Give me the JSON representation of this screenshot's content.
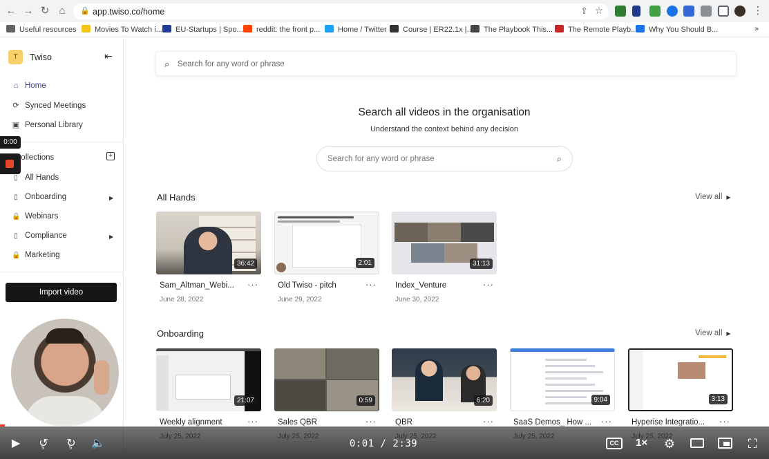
{
  "browser": {
    "url": "app.twiso.co/home",
    "bookmarks": [
      {
        "label": "Useful resources",
        "color": "#5f6368"
      },
      {
        "label": "Movies To Watch i...",
        "color": "#f5c518"
      },
      {
        "label": "EU-Startups | Spo...",
        "color": "#1f3b99"
      },
      {
        "label": "reddit: the front p...",
        "color": "#ff4500"
      },
      {
        "label": "Home / Twitter",
        "color": "#1da1f2"
      },
      {
        "label": "Course | ER22.1x |...",
        "color": "#333333"
      },
      {
        "label": "The Playbook This...",
        "color": "#444444"
      },
      {
        "label": "The Remote Playb...",
        "color": "#c62828"
      },
      {
        "label": "Why You Should B...",
        "color": "#1a73e8"
      }
    ],
    "more_bookmarks": "»"
  },
  "sidebar": {
    "org_initial": "T",
    "org_name": "Twiso",
    "nav": [
      {
        "label": "Home",
        "icon": "home-icon",
        "glyph": "⌂"
      },
      {
        "label": "Synced Meetings",
        "icon": "sync-icon",
        "glyph": "⟳"
      },
      {
        "label": "Personal Library",
        "icon": "library-icon",
        "glyph": "▣"
      }
    ],
    "collections_label": "Collections",
    "collections": [
      {
        "label": "All Hands",
        "icon": "document-icon",
        "glyph": "▯",
        "expandable": false
      },
      {
        "label": "Onboarding",
        "icon": "document-icon",
        "glyph": "▯",
        "expandable": true
      },
      {
        "label": "Webinars",
        "icon": "lock-icon",
        "glyph": "🔒",
        "expandable": false
      },
      {
        "label": "Compliance",
        "icon": "document-icon",
        "glyph": "▯",
        "expandable": true
      },
      {
        "label": "Marketing",
        "icon": "lock-icon",
        "glyph": "🔒",
        "expandable": false
      }
    ],
    "import_button": "Import video"
  },
  "recorder": {
    "timer": "0:00"
  },
  "main": {
    "top_search_placeholder": "Search for any word or phrase",
    "hero_title": "Search all videos in the organisation",
    "hero_subtitle": "Understand the context behind any decision",
    "hero_search_placeholder": "Search for any word or phrase",
    "view_all": "View all",
    "sections": [
      {
        "title": "All Hands",
        "videos": [
          {
            "title": "Sam_Altman_Webi...",
            "duration": "36:42",
            "date": "June 28, 2022",
            "thumb": "office"
          },
          {
            "title": "Old Twiso - pitch",
            "duration": "2:01",
            "date": "June 29, 2022",
            "thumb": "doc"
          },
          {
            "title": "Index_Venture",
            "duration": "31:13",
            "date": "June 30, 2022",
            "thumb": "grid"
          }
        ]
      },
      {
        "title": "Onboarding",
        "videos": [
          {
            "title": "Weekly alignment",
            "duration": "21:07",
            "date": "July 25, 2022",
            "thumb": "screen"
          },
          {
            "title": "Sales QBR",
            "duration": "0:59",
            "date": "July 25, 2022",
            "thumb": "meet"
          },
          {
            "title": "QBR",
            "duration": "6:20",
            "date": "July 25, 2022",
            "thumb": "room"
          },
          {
            "title": "SaaS Demos_ How ...",
            "duration": "9:04",
            "date": "July 25, 2022",
            "thumb": "browser"
          },
          {
            "title": "Hyperise Integratio...",
            "duration": "3:13",
            "date": "July 25, 2022",
            "thumb": "app"
          }
        ]
      }
    ]
  },
  "player": {
    "time": "0:01 / 2:39",
    "progress": 0.006,
    "speed": "1×",
    "cc": "CC",
    "skip_back": "5",
    "skip_forward": "5"
  }
}
